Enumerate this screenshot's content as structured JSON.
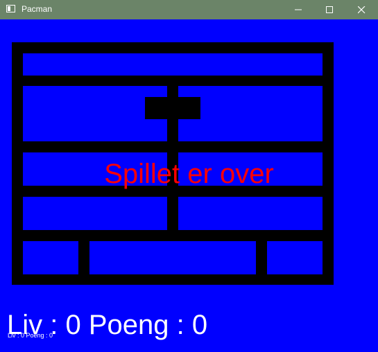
{
  "window": {
    "title": "Pacman",
    "app_icon": "window-app-icon",
    "controls": [
      "minimize-icon",
      "maximize-icon",
      "close-icon"
    ]
  },
  "colors": {
    "titlebar": "#6b8468",
    "background": "#0000ff",
    "wall": "#000000",
    "gameover_text": "#ff0000",
    "hud_text": "#ffffff"
  },
  "game": {
    "status_message": "Spillet er over"
  },
  "hud": {
    "lives_label": "Liv",
    "lives_value": "0",
    "score_label": "Poeng",
    "score_value": "0",
    "text": "Liv : 0  Poeng : 0",
    "small_text": "Liv : 0  Poeng : 0"
  }
}
